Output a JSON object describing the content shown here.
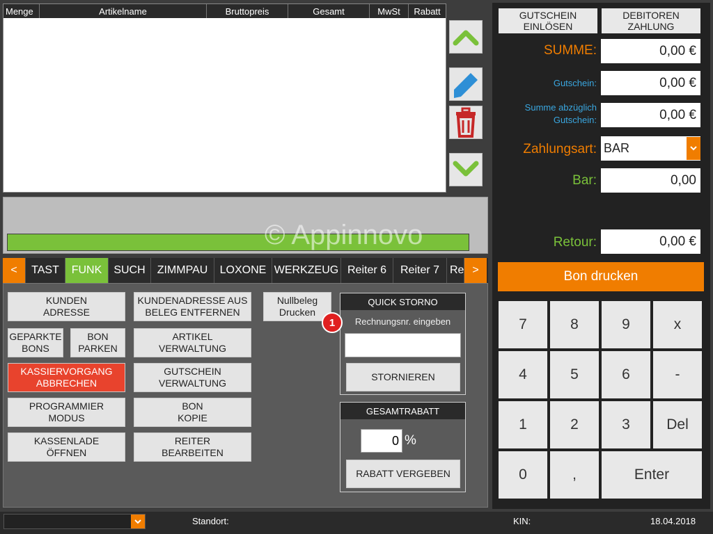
{
  "table": {
    "columns": [
      "Menge",
      "Artikelname",
      "Bruttopreis",
      "Gesamt",
      "MwSt",
      "Rabatt"
    ]
  },
  "watermark": "© Appinnovo",
  "icons": {
    "up": "chevron-up-icon",
    "edit": "pencil-icon",
    "delete": "trash-icon",
    "down": "chevron-down-icon"
  },
  "tabs": [
    "<",
    "TAST",
    "FUNK",
    "SUCH",
    "ZIMMPAU",
    "LOXONE",
    "WERKZEUG",
    "Reiter 6",
    "Reiter 7",
    "Re",
    ">"
  ],
  "active_tab": "FUNK",
  "functions": {
    "kunden_adresse": "KUNDEN\nADRESSE",
    "kundenadresse_entfernen": "KUNDENADRESSE AUS\nBELEG ENTFERNEN",
    "nullbeleg": "Nullbeleg\nDrucken",
    "geparkte_bons": "GEPARKTE\nBONS",
    "bon_parken": "BON\nPARKEN",
    "artikel_verwaltung": "ARTIKEL\nVERWALTUNG",
    "kassiervorgang_abbrechen": "KASSIERVORGANG\nABBRECHEN",
    "gutschein_verwaltung": "GUTSCHEIN\nVERWALTUNG",
    "programmier_modus": "PROGRAMMIER\nMODUS",
    "bon_kopie": "BON\nKOPIE",
    "kassenlade_oeffnen": "KASSENLADE\nÖFFNEN",
    "reiter_bearbeiten": "REITER\nBEARBEITEN"
  },
  "quick_storno": {
    "title": "QUICK STORNO",
    "prompt": "Rechnungsnr. eingeben",
    "input_value": "",
    "button": "STORNIEREN",
    "badge": "1"
  },
  "gesamtrabatt": {
    "title": "GESAMTRABATT",
    "value": "0",
    "unit": "%",
    "button": "RABATT VERGEBEN"
  },
  "payment": {
    "gutschein_einloesen": "GUTSCHEIN\nEINLÖSEN",
    "debitoren_zahlung": "DEBITOREN\nZAHLUNG",
    "summe_label": "SUMME:",
    "summe_value": "0,00 €",
    "gutschein_label": "Gutschein:",
    "gutschein_value": "0,00 €",
    "summe_abz_label": "Summe abzüglich\nGutschein:",
    "summe_abz_value": "0,00 €",
    "zahlungsart_label": "Zahlungsart:",
    "zahlungsart_value": "BAR",
    "bar_label": "Bar:",
    "bar_value": "0,00",
    "retour_label": "Retour:",
    "retour_value": "0,00 €",
    "bon_drucken": "Bon drucken"
  },
  "keypad": [
    "7",
    "8",
    "9",
    "x",
    "4",
    "5",
    "6",
    "-",
    "1",
    "2",
    "3",
    "Del",
    "0",
    ",",
    "Enter"
  ],
  "status": {
    "dropdown_value": "",
    "standort_label": "Standort:",
    "kin_label": "KIN:",
    "date": "18.04.2018"
  },
  "colors": {
    "accent_orange": "#f07d00",
    "accent_green": "#7ac13a",
    "danger_red": "#e8432d",
    "label_blue": "#3aa7e0"
  }
}
